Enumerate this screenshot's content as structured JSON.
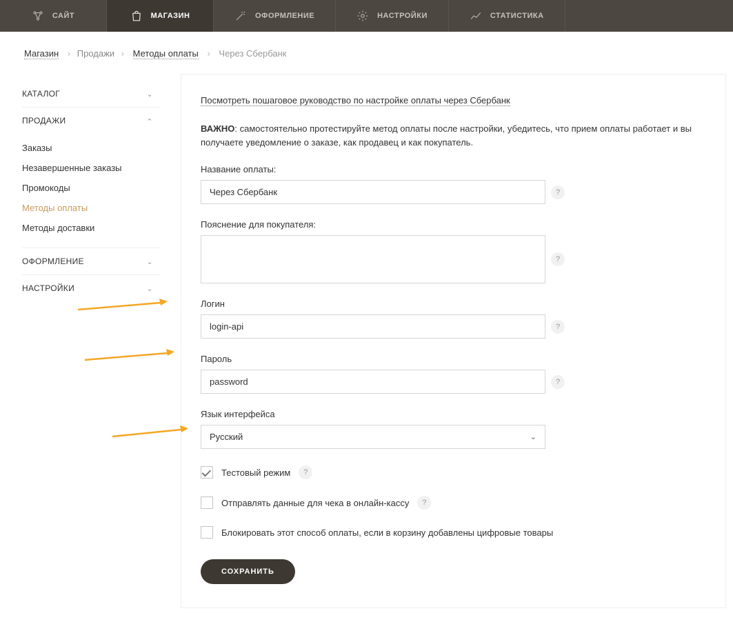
{
  "topnav": {
    "items": [
      {
        "label": "САЙТ"
      },
      {
        "label": "МАГАЗИН"
      },
      {
        "label": "ОФОРМЛЕНИЕ"
      },
      {
        "label": "НАСТРОЙКИ"
      },
      {
        "label": "СТАТИСТИКА"
      }
    ]
  },
  "breadcrumb": {
    "shop": "Магазин",
    "sales": "Продажи",
    "methods": "Методы оплаты",
    "current": "Через Сбербанк"
  },
  "sidebar": {
    "catalog": "КАТАЛОГ",
    "sales": "ПРОДАЖИ",
    "sales_items": {
      "orders": "Заказы",
      "pending": "Незавершенные заказы",
      "promo": "Промокоды",
      "pay": "Методы оплаты",
      "delivery": "Методы доставки"
    },
    "design": "ОФОРМЛЕНИЕ",
    "settings": "НАСТРОЙКИ"
  },
  "main": {
    "guide_link": "Посмотреть пошаговое руководство по настройке оплаты через Сбербанк",
    "important_label": "ВАЖНО",
    "important_text": ": самостоятельно протестируйте метод оплаты после настройки, убедитесь, что прием оплаты работает и вы получаете уведомление о заказе, как продавец и как покупатель.",
    "name_label": "Название оплаты:",
    "name_value": "Через Сбербанк",
    "desc_label": "Пояснение для покупателя:",
    "desc_value": "",
    "login_label": "Логин",
    "login_value": "login-api",
    "password_label": "Пароль",
    "password_value": "password",
    "lang_label": "Язык интерфейса",
    "lang_value": "Русский",
    "test_mode": "Тестовый режим",
    "send_receipt": "Отправлять данные для чека в онлайн-кассу",
    "block_digital": "Блокировать этот способ оплаты, если в корзину добавлены цифровые товары",
    "save": "СОХРАНИТЬ",
    "help": "?"
  }
}
